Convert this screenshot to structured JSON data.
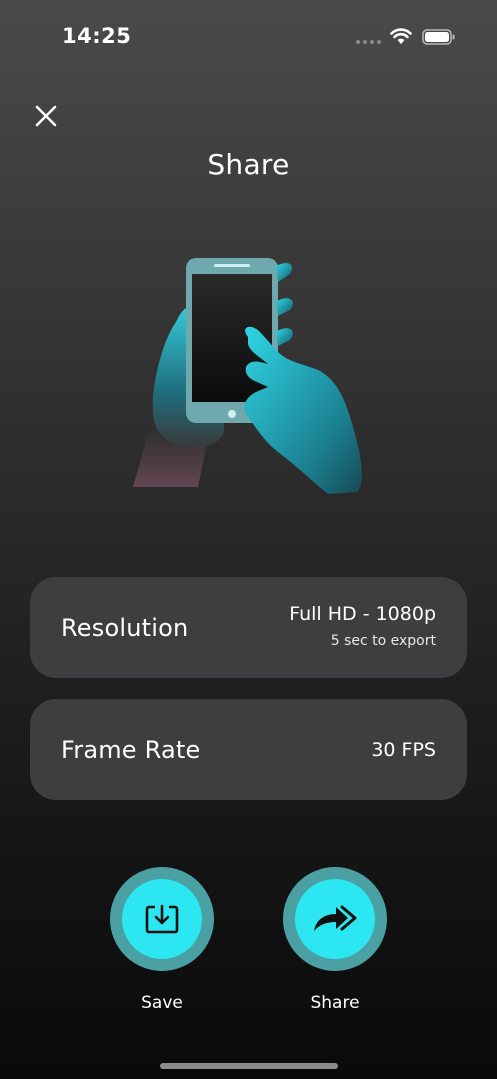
{
  "status_bar": {
    "time": "14:25"
  },
  "header": {
    "title": "Share"
  },
  "settings": {
    "resolution": {
      "label": "Resolution",
      "value": "Full HD - 1080p",
      "subtext": "5 sec to export"
    },
    "frame_rate": {
      "label": "Frame Rate",
      "value": "30 FPS"
    }
  },
  "actions": {
    "save_label": "Save",
    "share_label": "Share"
  },
  "colors": {
    "accent": "#2ce6f2",
    "accent_ring": "#4aa0a2",
    "card_background": "#3e3e40"
  },
  "icons": {
    "close": "close-icon",
    "save": "download-icon",
    "share": "forward-share-icon",
    "wifi": "wifi-icon",
    "battery": "battery-icon"
  }
}
